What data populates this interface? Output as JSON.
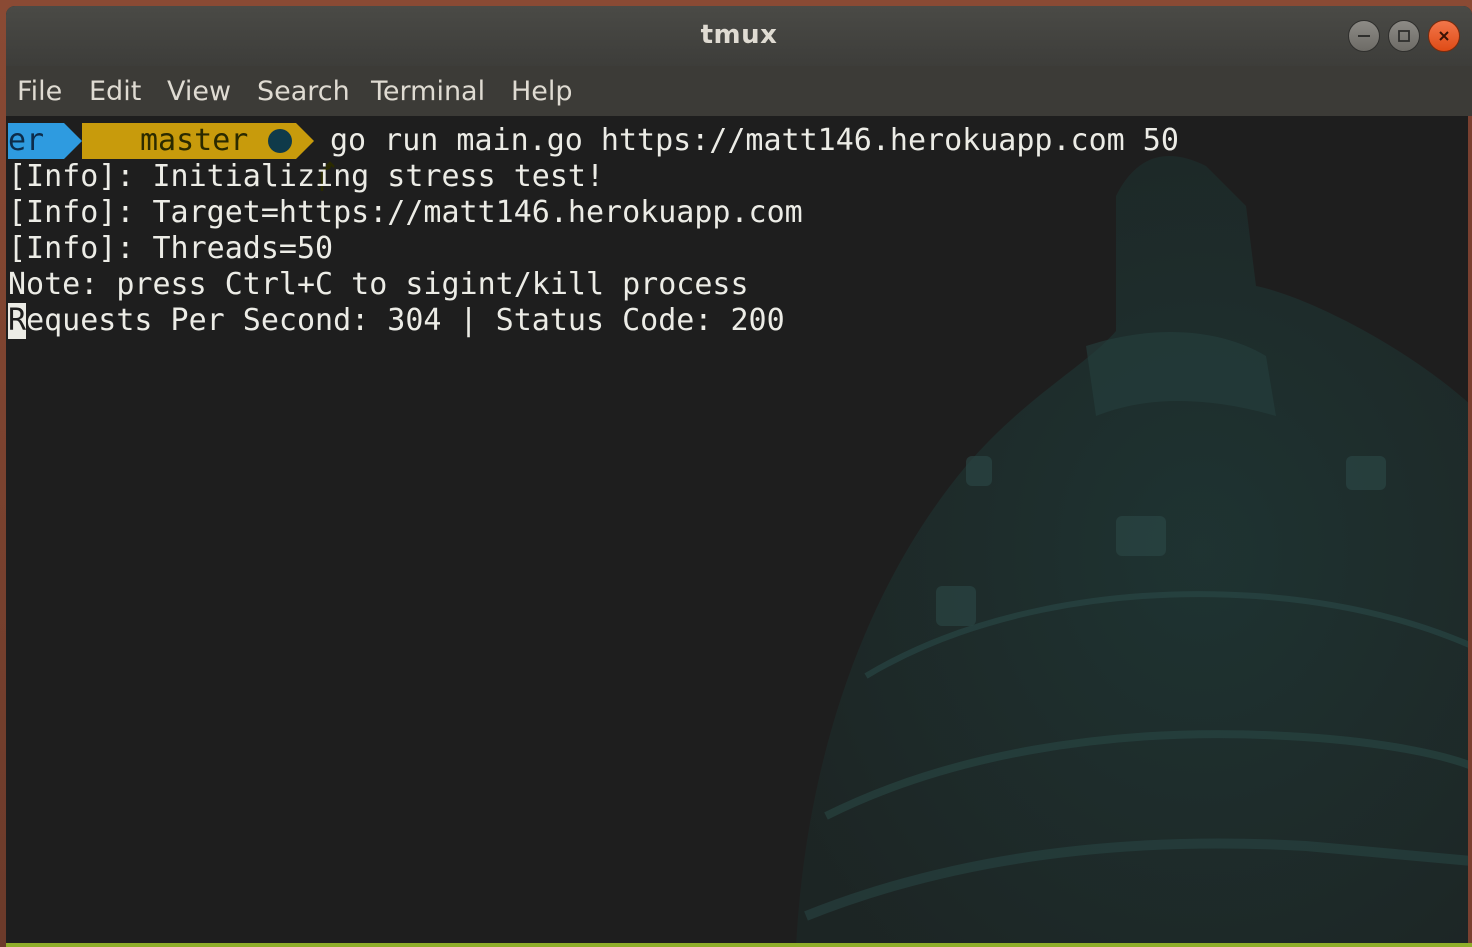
{
  "window": {
    "title": "tmux",
    "controls": {
      "minimize_icon": "minimize-icon",
      "maximize_icon": "maximize-icon",
      "close_icon": "close-icon"
    }
  },
  "menubar": {
    "items": [
      "File",
      "Edit",
      "View",
      "Search",
      "Terminal",
      "Help"
    ]
  },
  "terminal": {
    "prompt": {
      "dir_segment": "er",
      "branch_icon": "git-branch-icon",
      "branch": "master",
      "status_icon": "git-status-dot-icon",
      "command": "go run main.go https://matt146.herokuapp.com 50"
    },
    "output": [
      "[Info]: Initializing stress test!",
      "[Info]: Target=https://matt146.herokuapp.com",
      "[Info]: Threads=50",
      "Note: press Ctrl+C to sigint/kill process"
    ],
    "last_line": {
      "cursor_char": "R",
      "rest": "equests Per Second: 304 | Status Code: 200"
    }
  },
  "colors": {
    "terminal_bg": "#1e1e1e",
    "text": "#ecece6",
    "prompt_blue": "#2e9be0",
    "prompt_gold": "#c89b0c",
    "close_button": "#df4b16",
    "titlebar": "#3d3d3a"
  }
}
